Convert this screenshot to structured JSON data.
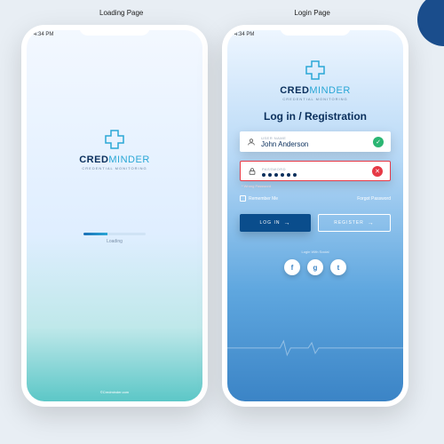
{
  "page_labels": {
    "loading": "Loading Page",
    "login": "Login Page"
  },
  "status_time": "4:34 PM",
  "brand": {
    "name_part1": "CRED",
    "name_part2": "MINDER",
    "tagline": "CREDENTIAL MONITORING",
    "footer": "©Credminder.com"
  },
  "loading": {
    "label": "Loading",
    "progress_pct": 38
  },
  "login": {
    "heading": "Log in / Registration",
    "username": {
      "label": "USER NAME",
      "value": "John Anderson",
      "valid": true
    },
    "password": {
      "label": "PASSWORD",
      "value": "●●●●●●",
      "valid": false
    },
    "error_text": "* Wrong Password",
    "remember": "Remember Me",
    "forgot": "Forgot Password",
    "login_btn": "LOG IN",
    "register_btn": "REGISTER",
    "social_label": "Login With Social",
    "social": {
      "fb": "f",
      "google": "g",
      "twitter": "t"
    }
  },
  "colors": {
    "navy": "#0a2f5c",
    "blue": "#2aa7d6",
    "error": "#e63946",
    "success": "#2bb673"
  }
}
